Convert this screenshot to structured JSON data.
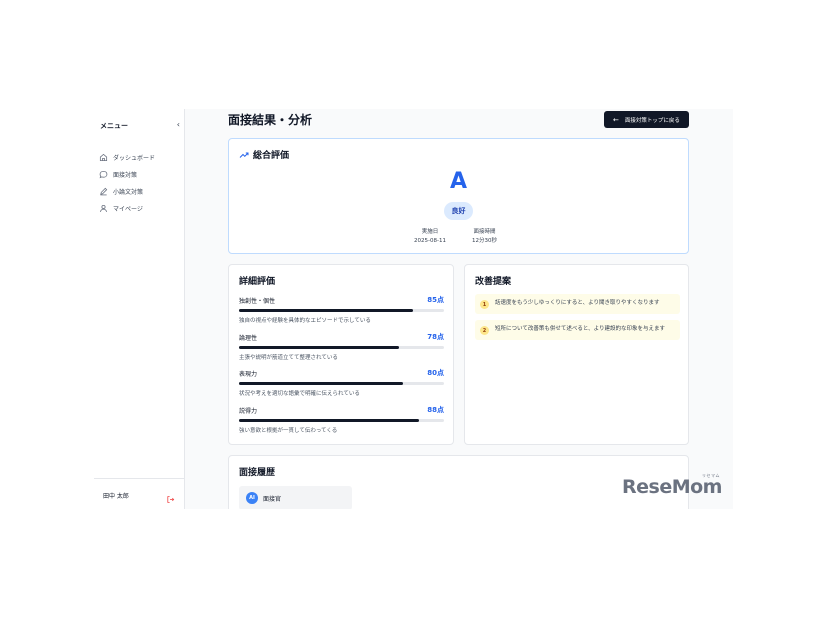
{
  "sidebar": {
    "title": "メニュー",
    "collapse_icon": "chevron-left-icon",
    "items": [
      {
        "label": "ダッシュボード",
        "icon": "home-icon"
      },
      {
        "label": "面接対策",
        "icon": "chat-bubble-icon"
      },
      {
        "label": "小論文対策",
        "icon": "pen-icon"
      },
      {
        "label": "マイページ",
        "icon": "user-icon"
      }
    ],
    "user_name": "田中 太郎",
    "logout_icon": "logout-icon"
  },
  "header": {
    "title": "面接結果・分析",
    "back_button": "面接対策トップに戻る",
    "back_icon": "arrow-left-icon"
  },
  "overall": {
    "title": "総合評価",
    "icon": "trending-up-icon",
    "grade": "A",
    "grade_label": "良好",
    "date_label": "実施日",
    "date": "2025-08-11",
    "duration_label": "面接時間",
    "duration": "12分30秒"
  },
  "detail": {
    "title": "詳細評価",
    "criteria": [
      {
        "name": "独創性・個性",
        "score": "85点",
        "value": 85,
        "desc": "独自の視点や経験を具体的なエピソードで示している"
      },
      {
        "name": "論理性",
        "score": "78点",
        "value": 78,
        "desc": "主張や説明が筋道立てて整理されている"
      },
      {
        "name": "表現力",
        "score": "80点",
        "value": 80,
        "desc": "状況や考えを適切な語彙で明確に伝えられている"
      },
      {
        "name": "説得力",
        "score": "88点",
        "value": 88,
        "desc": "強い意欲と根拠が一貫して伝わってくる"
      }
    ]
  },
  "improve": {
    "title": "改善提案",
    "suggestions": [
      {
        "num": "1",
        "text": "話速度をもう少しゆっくりにすると、より聞き取りやすくなります"
      },
      {
        "num": "2",
        "text": "短所について改善策も併せて述べると、より建設的な印象を与えます"
      }
    ]
  },
  "history": {
    "title": "面接履歴",
    "items": [
      {
        "avatar": "AI",
        "label": "面接官"
      }
    ]
  },
  "watermark": {
    "text": "ReseMom",
    "kana": "リセマム"
  },
  "colors": {
    "accent": "#2563eb",
    "dark": "#111827",
    "suggestion_bg": "#fefce8"
  }
}
